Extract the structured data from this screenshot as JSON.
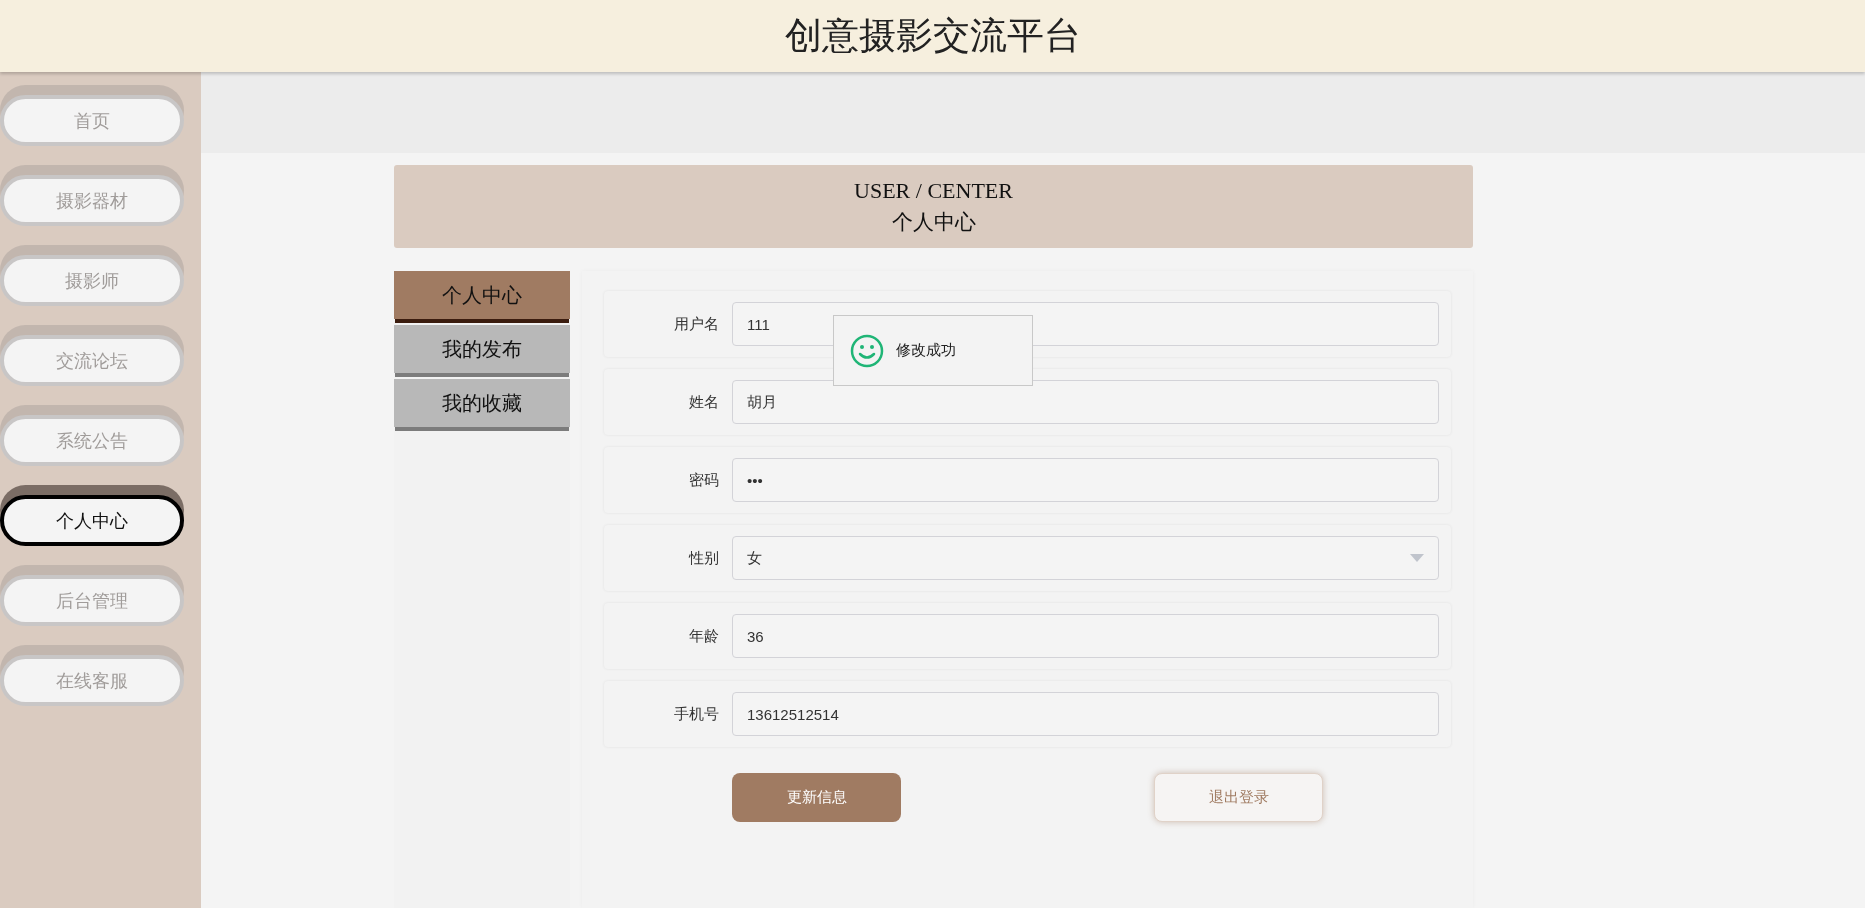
{
  "header": {
    "title": "创意摄影交流平台"
  },
  "sidebar": {
    "items": [
      {
        "label": "首页",
        "selected": false
      },
      {
        "label": "摄影器材",
        "selected": false
      },
      {
        "label": "摄影师",
        "selected": false
      },
      {
        "label": "交流论坛",
        "selected": false
      },
      {
        "label": "系统公告",
        "selected": false
      },
      {
        "label": "个人中心",
        "selected": true
      },
      {
        "label": "后台管理",
        "selected": false
      },
      {
        "label": "在线客服",
        "selected": false
      }
    ]
  },
  "banner": {
    "title": "USER / CENTER",
    "subtitle": "个人中心"
  },
  "tabs": [
    {
      "label": "个人中心",
      "selected": true
    },
    {
      "label": "我的发布",
      "selected": false
    },
    {
      "label": "我的收藏",
      "selected": false
    }
  ],
  "form": {
    "fields": [
      {
        "kind": "text",
        "label": "用户名",
        "value": "111"
      },
      {
        "kind": "text",
        "label": "姓名",
        "value": "胡月"
      },
      {
        "kind": "text",
        "label": "密码",
        "value": "•••"
      },
      {
        "kind": "select",
        "label": "性别",
        "value": "女"
      },
      {
        "kind": "text",
        "label": "年龄",
        "value": "36"
      },
      {
        "kind": "text",
        "label": "手机号",
        "value": "13612512514"
      }
    ],
    "buttons": [
      {
        "kind": "primary",
        "label": "更新信息"
      },
      {
        "kind": "secondary",
        "label": "退出登录"
      }
    ]
  },
  "toast": {
    "message": "修改成功"
  }
}
